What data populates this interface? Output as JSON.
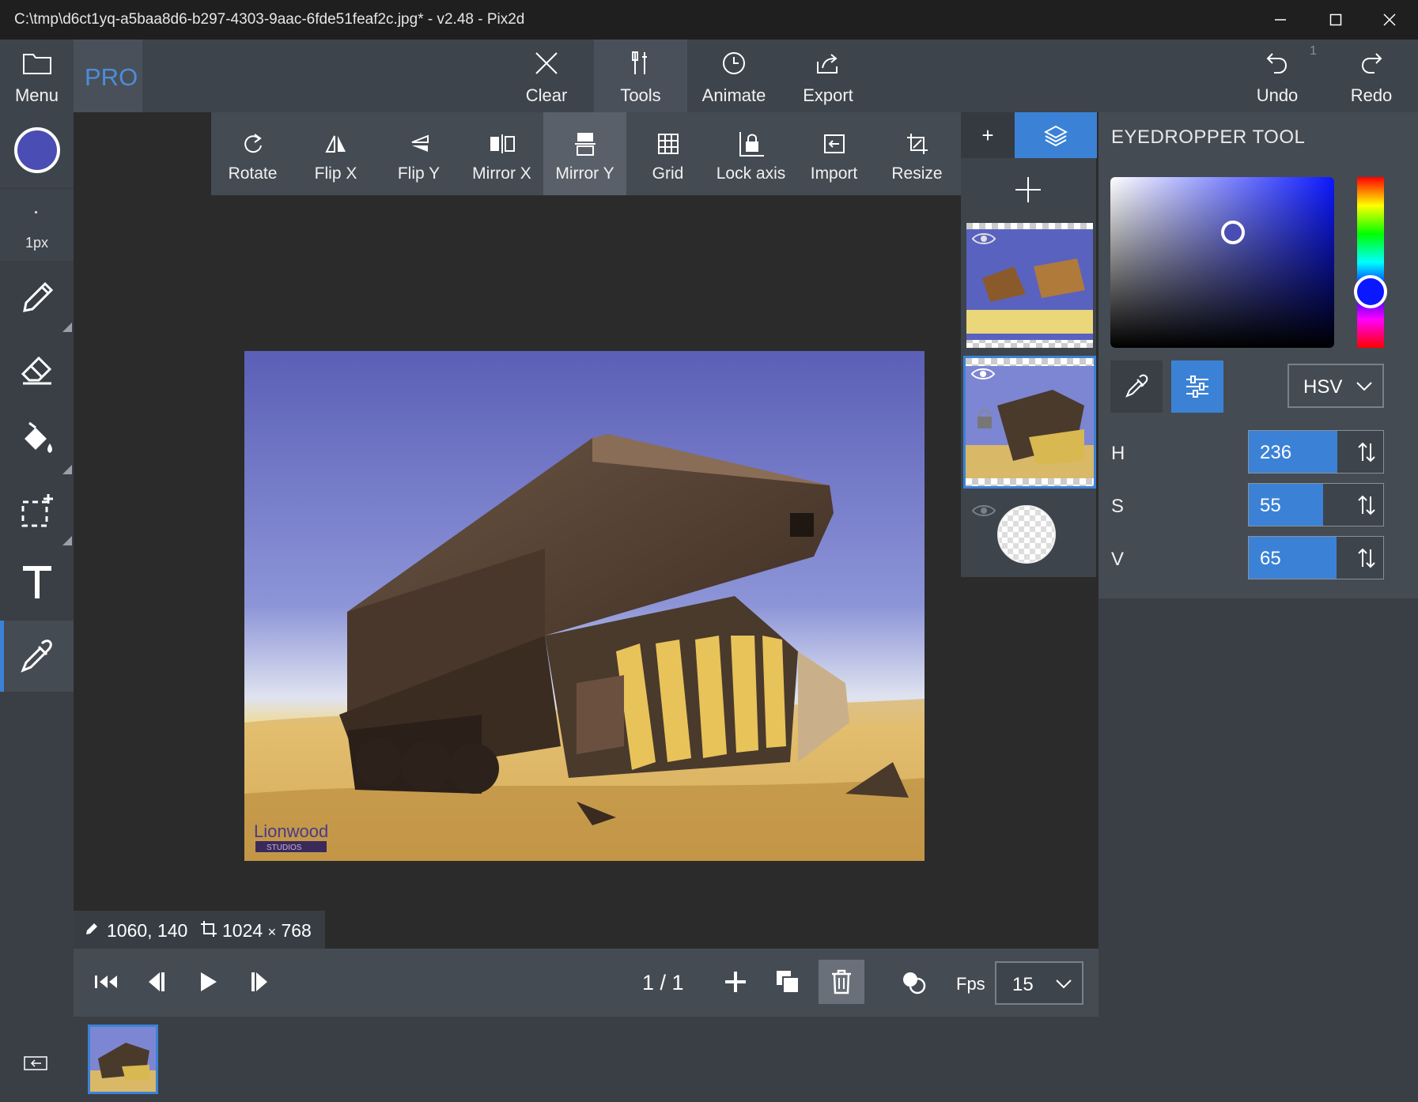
{
  "window": {
    "title": "C:\\tmp\\d6ct1yq-a5baa8d6-b297-4303-9aac-6fde51feaf2c.jpg* - v2.48 - Pix2d"
  },
  "main_toolbar": {
    "menu_label": "Menu",
    "pro_label": "PRO",
    "clear_label": "Clear",
    "tools_label": "Tools",
    "animate_label": "Animate",
    "export_label": "Export",
    "undo_label": "Undo",
    "undo_count": "1",
    "redo_label": "Redo"
  },
  "left_tools": {
    "brush_size": "1px",
    "brush_color": "#4a4db3",
    "items": [
      "pencil",
      "eraser",
      "fill",
      "selection",
      "text",
      "eyedropper"
    ],
    "active": "eyedropper"
  },
  "tools_panel": {
    "items": [
      {
        "label": "Rotate",
        "icon": "rotate-icon"
      },
      {
        "label": "Flip X",
        "icon": "flip-x-icon"
      },
      {
        "label": "Flip Y",
        "icon": "flip-y-icon"
      },
      {
        "label": "Mirror X",
        "icon": "mirror-x-icon"
      },
      {
        "label": "Mirror Y",
        "icon": "mirror-y-icon"
      },
      {
        "label": "Grid",
        "icon": "grid-icon"
      },
      {
        "label": "Lock axis",
        "icon": "lock-axis-icon"
      },
      {
        "label": "Import",
        "icon": "import-icon"
      },
      {
        "label": "Resize",
        "icon": "resize-icon"
      }
    ],
    "active": "Mirror Y"
  },
  "layers": {
    "add_small": "+",
    "selected_index": 1,
    "count": 3
  },
  "color_panel": {
    "title": "EYEDROPPER TOOL",
    "mode": "HSV",
    "h": {
      "label": "H",
      "value": "236",
      "fraction": 0.66
    },
    "s": {
      "label": "S",
      "value": "55",
      "fraction": 0.55
    },
    "v": {
      "label": "V",
      "value": "65",
      "fraction": 0.65
    },
    "hue_color": "#0b18ff",
    "picked_color": "#4a4db3"
  },
  "status": {
    "cursor": "1060, 140",
    "size_w": "1024",
    "size_x": "×",
    "size_h": "768"
  },
  "timeline": {
    "frame_counter": "1 / 1",
    "fps_label": "Fps",
    "fps_value": "15"
  },
  "canvas": {
    "watermark_line1": "Lionwood",
    "watermark_line2": "STUDIOS"
  }
}
